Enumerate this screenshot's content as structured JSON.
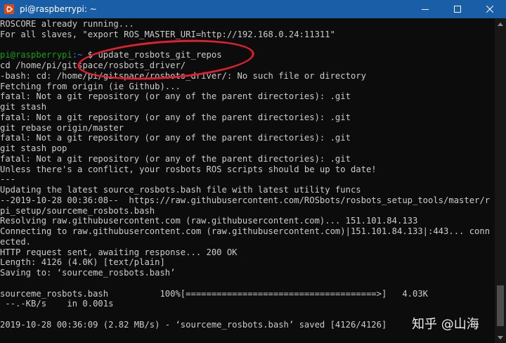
{
  "window": {
    "title": "pi@raspberrypi: ~",
    "icon": "ubuntu-icon",
    "controls": [
      "minimize-icon",
      "maximize-icon",
      "close-icon"
    ]
  },
  "prompt": {
    "user_host": "pi@raspberrypi",
    "path": ":~",
    "symbol": " $ ",
    "command": "update_rosbots_git_repos"
  },
  "terminal": {
    "lines_before": [
      "ROSCORE already running...",
      "For all slaves, \"export ROS_MASTER_URI=http://192.168.0.24:11311\"",
      ""
    ],
    "lines_after": [
      "cd /home/pi/gitspace/rosbots_driver/",
      "-bash: cd: /home/pi/gitspace/rosbots_driver/: No such file or directory",
      "Fetching from origin (ie Github)...",
      "fatal: Not a git repository (or any of the parent directories): .git",
      "git stash",
      "fatal: Not a git repository (or any of the parent directories): .git",
      "git rebase origin/master",
      "fatal: Not a git repository (or any of the parent directories): .git",
      "git stash pop",
      "fatal: Not a git repository (or any of the parent directories): .git",
      "Unless there's a conflict, your rosbots ROS scripts should be up to date!",
      "---",
      "Updating the latest source_rosbots.bash file with latest utility funcs",
      "--2019-10-28 00:36:08--  https://raw.githubusercontent.com/ROSbots/rosbots_setup_tools/master/r",
      "pi_setup/sourceme_rosbots.bash",
      "Resolving raw.githubusercontent.com (raw.githubusercontent.com)... 151.101.84.133",
      "Connecting to raw.githubusercontent.com (raw.githubusercontent.com)|151.101.84.133|:443... conn",
      "ected.",
      "HTTP request sent, awaiting response... 200 OK",
      "Length: 4126 (4.0K) [text/plain]",
      "Saving to: ‘sourceme_rosbots.bash’",
      "",
      "sourceme_rosbots.bash          100%[=====================================>]   4.03K",
      " --.-KB/s    in 0.001s",
      "",
      "2019-10-28 00:36:09 (2.82 MB/s) - ‘sourceme_rosbots.bash’ saved [4126/4126]"
    ]
  },
  "watermark": "知乎 @山海",
  "colors": {
    "titlebar": "#1a5ea8",
    "background": "#0c0c0c",
    "text": "#cccccc",
    "prompt_user": "#13a10e",
    "prompt_path": "#3b78ff",
    "annotation": "#e0202f"
  }
}
